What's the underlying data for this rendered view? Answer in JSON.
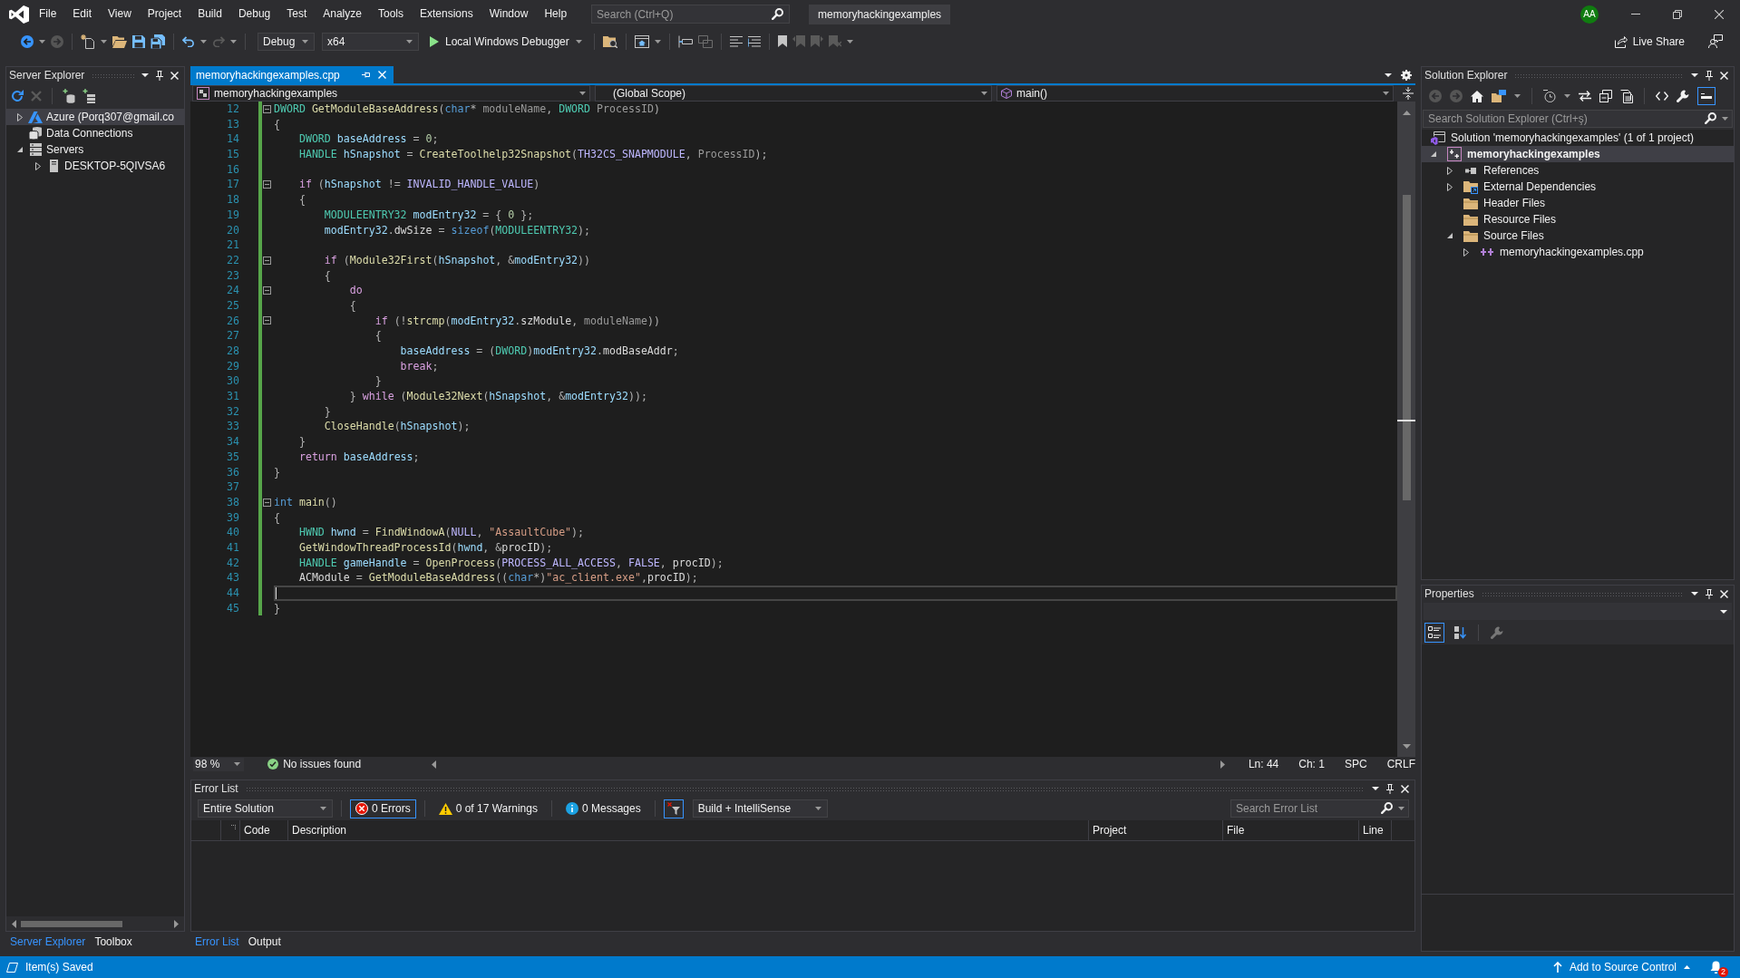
{
  "title_bar": {
    "menu": [
      "File",
      "Edit",
      "View",
      "Project",
      "Build",
      "Debug",
      "Test",
      "Analyze",
      "Tools",
      "Extensions",
      "Window",
      "Help"
    ],
    "search": {
      "placeholder": "Search (Ctrl+Q)"
    },
    "solution_name": "memoryhackingexamples",
    "account_initials": "AA"
  },
  "toolbar": {
    "configuration": "Debug",
    "platform": "x64",
    "debugger": "Local Windows Debugger",
    "live_share": "Live Share"
  },
  "server_explorer": {
    "title": "Server Explorer",
    "tree": [
      {
        "label": "Azure (Porq307@gmail.co",
        "kind": "azure",
        "expanded": false,
        "selected": true
      },
      {
        "label": "Data Connections",
        "kind": "data-connections",
        "selected": false
      },
      {
        "label": "Servers",
        "kind": "servers",
        "expanded": true,
        "selected": false,
        "children": [
          {
            "label": "DESKTOP-5QIVSA6",
            "kind": "server",
            "expanded": false,
            "selected": false
          }
        ]
      }
    ],
    "tabs": [
      {
        "label": "Server Explorer",
        "selected": true
      },
      {
        "label": "Toolbox",
        "selected": false
      }
    ]
  },
  "editor": {
    "tab": {
      "label": "memoryhackingexamples.cpp",
      "selected": true
    },
    "navigation": {
      "project": "memoryhackingexamples",
      "scope": "(Global Scope)",
      "member": "main()"
    },
    "lines": [
      {
        "number": "12",
        "fold": true,
        "current": false,
        "tokens": [
          {
            "kind": "type",
            "text": "DWORD "
          },
          {
            "kind": "function",
            "text": "GetModuleBaseAddress"
          },
          {
            "kind": "plain",
            "text": "("
          },
          {
            "kind": "keyword",
            "text": "char"
          },
          {
            "kind": "plain",
            "text": "* "
          },
          {
            "kind": "parameter",
            "text": "moduleName"
          },
          {
            "kind": "plain",
            "text": ", "
          },
          {
            "kind": "type",
            "text": "DWORD "
          },
          {
            "kind": "parameter",
            "text": "ProcessID"
          },
          {
            "kind": "plain",
            "text": ")"
          }
        ]
      },
      {
        "number": "13",
        "fold": false,
        "current": false,
        "tokens": [
          {
            "kind": "plain",
            "text": "{"
          }
        ]
      },
      {
        "number": "14",
        "fold": false,
        "current": false,
        "tokens": [
          {
            "kind": "type",
            "text": "    DWORD "
          },
          {
            "kind": "variable",
            "text": "baseAddress"
          },
          {
            "kind": "plain",
            "text": " = "
          },
          {
            "kind": "number",
            "text": "0"
          },
          {
            "kind": "plain",
            "text": ";"
          }
        ]
      },
      {
        "number": "15",
        "fold": false,
        "current": false,
        "tokens": [
          {
            "kind": "type",
            "text": "    HANDLE "
          },
          {
            "kind": "variable",
            "text": "hSnapshot"
          },
          {
            "kind": "plain",
            "text": " = "
          },
          {
            "kind": "function",
            "text": "CreateToolhelp32Snapshot"
          },
          {
            "kind": "plain",
            "text": "("
          },
          {
            "kind": "macro",
            "text": "TH32CS_SNAPMODULE"
          },
          {
            "kind": "plain",
            "text": ", "
          },
          {
            "kind": "parameter",
            "text": "ProcessID"
          },
          {
            "kind": "plain",
            "text": ");"
          }
        ]
      },
      {
        "number": "16",
        "fold": false,
        "current": false
      },
      {
        "number": "17",
        "fold": true,
        "current": false,
        "tokens": [
          {
            "kind": "control",
            "text": "    if"
          },
          {
            "kind": "plain",
            "text": " ("
          },
          {
            "kind": "variable",
            "text": "hSnapshot"
          },
          {
            "kind": "plain",
            "text": " != "
          },
          {
            "kind": "macro",
            "text": "INVALID_HANDLE_VALUE"
          },
          {
            "kind": "plain",
            "text": ")"
          }
        ]
      },
      {
        "number": "18",
        "fold": false,
        "current": false,
        "tokens": [
          {
            "kind": "plain",
            "text": "    {"
          }
        ]
      },
      {
        "number": "19",
        "fold": false,
        "current": false,
        "tokens": [
          {
            "kind": "type",
            "text": "        MODULEENTRY32 "
          },
          {
            "kind": "variable",
            "text": "modEntry32"
          },
          {
            "kind": "plain",
            "text": " = { "
          },
          {
            "kind": "number",
            "text": "0"
          },
          {
            "kind": "plain",
            "text": " };"
          }
        ]
      },
      {
        "number": "20",
        "fold": false,
        "current": false,
        "tokens": [
          {
            "kind": "variable",
            "text": "        modEntry32"
          },
          {
            "kind": "plain",
            "text": "."
          },
          {
            "kind": "member",
            "text": "dwSize"
          },
          {
            "kind": "plain",
            "text": " = "
          },
          {
            "kind": "keyword",
            "text": "sizeof"
          },
          {
            "kind": "plain",
            "text": "("
          },
          {
            "kind": "type",
            "text": "MODULEENTRY32"
          },
          {
            "kind": "plain",
            "text": ");"
          }
        ]
      },
      {
        "number": "21",
        "fold": false,
        "current": false
      },
      {
        "number": "22",
        "fold": true,
        "current": false,
        "tokens": [
          {
            "kind": "control",
            "text": "        if"
          },
          {
            "kind": "plain",
            "text": " ("
          },
          {
            "kind": "function",
            "text": "Module32First"
          },
          {
            "kind": "plain",
            "text": "("
          },
          {
            "kind": "variable",
            "text": "hSnapshot"
          },
          {
            "kind": "plain",
            "text": ", &"
          },
          {
            "kind": "variable",
            "text": "modEntry32"
          },
          {
            "kind": "plain",
            "text": "))"
          }
        ]
      },
      {
        "number": "23",
        "fold": false,
        "current": false,
        "tokens": [
          {
            "kind": "plain",
            "text": "        {"
          }
        ]
      },
      {
        "number": "24",
        "fold": true,
        "current": false,
        "tokens": [
          {
            "kind": "control",
            "text": "            do"
          }
        ]
      },
      {
        "number": "25",
        "fold": false,
        "current": false,
        "tokens": [
          {
            "kind": "plain",
            "text": "            {"
          }
        ]
      },
      {
        "number": "26",
        "fold": true,
        "current": false,
        "tokens": [
          {
            "kind": "control",
            "text": "                if"
          },
          {
            "kind": "plain",
            "text": " (!"
          },
          {
            "kind": "function",
            "text": "strcmp"
          },
          {
            "kind": "plain",
            "text": "("
          },
          {
            "kind": "variable",
            "text": "modEntry32"
          },
          {
            "kind": "plain",
            "text": "."
          },
          {
            "kind": "member",
            "text": "szModule"
          },
          {
            "kind": "plain",
            "text": ", "
          },
          {
            "kind": "parameter",
            "text": "moduleName"
          },
          {
            "kind": "plain",
            "text": "))"
          }
        ]
      },
      {
        "number": "27",
        "fold": false,
        "current": false,
        "tokens": [
          {
            "kind": "plain",
            "text": "                {"
          }
        ]
      },
      {
        "number": "28",
        "fold": false,
        "current": false,
        "tokens": [
          {
            "kind": "variable",
            "text": "                    baseAddress"
          },
          {
            "kind": "plain",
            "text": " = ("
          },
          {
            "kind": "type",
            "text": "DWORD"
          },
          {
            "kind": "plain",
            "text": ")"
          },
          {
            "kind": "variable",
            "text": "modEntry32"
          },
          {
            "kind": "plain",
            "text": "."
          },
          {
            "kind": "member",
            "text": "modBaseAddr"
          },
          {
            "kind": "plain",
            "text": ";"
          }
        ]
      },
      {
        "number": "29",
        "fold": false,
        "current": false,
        "tokens": [
          {
            "kind": "control",
            "text": "                    break"
          },
          {
            "kind": "plain",
            "text": ";"
          }
        ]
      },
      {
        "number": "30",
        "fold": false,
        "current": false,
        "tokens": [
          {
            "kind": "plain",
            "text": "                }"
          }
        ]
      },
      {
        "number": "31",
        "fold": false,
        "current": false,
        "tokens": [
          {
            "kind": "plain",
            "text": "            } "
          },
          {
            "kind": "control",
            "text": "while"
          },
          {
            "kind": "plain",
            "text": " ("
          },
          {
            "kind": "function",
            "text": "Module32Next"
          },
          {
            "kind": "plain",
            "text": "("
          },
          {
            "kind": "variable",
            "text": "hSnapshot"
          },
          {
            "kind": "plain",
            "text": ", &"
          },
          {
            "kind": "variable",
            "text": "modEntry32"
          },
          {
            "kind": "plain",
            "text": "));"
          }
        ]
      },
      {
        "number": "32",
        "fold": false,
        "current": false,
        "tokens": [
          {
            "kind": "plain",
            "text": "        }"
          }
        ]
      },
      {
        "number": "33",
        "fold": false,
        "current": false,
        "tokens": [
          {
            "kind": "function",
            "text": "        CloseHandle"
          },
          {
            "kind": "plain",
            "text": "("
          },
          {
            "kind": "variable",
            "text": "hSnapshot"
          },
          {
            "kind": "plain",
            "text": ");"
          }
        ]
      },
      {
        "number": "34",
        "fold": false,
        "current": false,
        "tokens": [
          {
            "kind": "plain",
            "text": "    }"
          }
        ]
      },
      {
        "number": "35",
        "fold": false,
        "current": false,
        "tokens": [
          {
            "kind": "control",
            "text": "    return "
          },
          {
            "kind": "variable",
            "text": "baseAddress"
          },
          {
            "kind": "plain",
            "text": ";"
          }
        ]
      },
      {
        "number": "36",
        "fold": false,
        "current": false,
        "tokens": [
          {
            "kind": "plain",
            "text": "}"
          }
        ]
      },
      {
        "number": "37",
        "fold": false,
        "current": false
      },
      {
        "number": "38",
        "fold": true,
        "current": false,
        "tokens": [
          {
            "kind": "keyword",
            "text": "int "
          },
          {
            "kind": "function",
            "text": "main"
          },
          {
            "kind": "plain",
            "text": "()"
          }
        ]
      },
      {
        "number": "39",
        "fold": false,
        "current": false,
        "tokens": [
          {
            "kind": "plain",
            "text": "{"
          }
        ]
      },
      {
        "number": "40",
        "fold": false,
        "current": false,
        "tokens": [
          {
            "kind": "type",
            "text": "    HWND "
          },
          {
            "kind": "variable",
            "text": "hwnd"
          },
          {
            "kind": "plain",
            "text": " = "
          },
          {
            "kind": "function",
            "text": "FindWindowA"
          },
          {
            "kind": "plain",
            "text": "("
          },
          {
            "kind": "macro",
            "text": "NULL"
          },
          {
            "kind": "plain",
            "text": ", "
          },
          {
            "kind": "string",
            "text": "\"AssaultCube\""
          },
          {
            "kind": "plain",
            "text": ");"
          }
        ]
      },
      {
        "number": "41",
        "fold": false,
        "current": false,
        "tokens": [
          {
            "kind": "function",
            "text": "    GetWindowThreadProcessId"
          },
          {
            "kind": "plain",
            "text": "("
          },
          {
            "kind": "variable",
            "text": "hwnd"
          },
          {
            "kind": "plain",
            "text": ", &"
          },
          {
            "kind": "global",
            "text": "procID"
          },
          {
            "kind": "plain",
            "text": ");"
          }
        ]
      },
      {
        "number": "42",
        "fold": false,
        "current": false,
        "tokens": [
          {
            "kind": "type",
            "text": "    HANDLE "
          },
          {
            "kind": "variable",
            "text": "gameHandle"
          },
          {
            "kind": "plain",
            "text": " = "
          },
          {
            "kind": "function",
            "text": "OpenProcess"
          },
          {
            "kind": "plain",
            "text": "("
          },
          {
            "kind": "macro",
            "text": "PROCESS_ALL_ACCESS"
          },
          {
            "kind": "plain",
            "text": ", "
          },
          {
            "kind": "macro",
            "text": "FALSE"
          },
          {
            "kind": "plain",
            "text": ", "
          },
          {
            "kind": "global",
            "text": "procID"
          },
          {
            "kind": "plain",
            "text": ");"
          }
        ]
      },
      {
        "number": "43",
        "fold": false,
        "current": false,
        "tokens": [
          {
            "kind": "global",
            "text": "    ACModule"
          },
          {
            "kind": "plain",
            "text": " = "
          },
          {
            "kind": "function",
            "text": "GetModuleBaseAddress"
          },
          {
            "kind": "plain",
            "text": "(("
          },
          {
            "kind": "keyword",
            "text": "char"
          },
          {
            "kind": "plain",
            "text": "*)"
          },
          {
            "kind": "string",
            "text": "\"ac_client.exe\""
          },
          {
            "kind": "plain",
            "text": ","
          },
          {
            "kind": "global",
            "text": "procID"
          },
          {
            "kind": "plain",
            "text": ");"
          }
        ]
      },
      {
        "number": "44",
        "fold": false,
        "current": true
      },
      {
        "number": "45",
        "fold": false,
        "current": false,
        "tokens": [
          {
            "kind": "plain",
            "text": "}"
          }
        ]
      }
    ],
    "status": {
      "zoom": "98 %",
      "issues": "No issues found",
      "line": "Ln: 44",
      "column": "Ch: 1",
      "whitespace": "SPC",
      "line_endings": "CRLF"
    }
  },
  "error_list": {
    "title": "Error List",
    "scope": "Entire Solution",
    "filters": [
      {
        "kind": "error",
        "label": "0 Errors",
        "on": true
      },
      {
        "kind": "warning",
        "label": "0 of 17 Warnings",
        "on": false
      },
      {
        "kind": "message",
        "label": "0 Messages",
        "on": false
      }
    ],
    "filter_toggle": {
      "on": true
    },
    "source": "Build + IntelliSense",
    "search": {
      "placeholder": "Search Error List"
    },
    "columns": [
      "Code",
      "Description",
      "Project",
      "File",
      "Line"
    ],
    "tabs": [
      {
        "label": "Error List",
        "selected": true
      },
      {
        "label": "Output",
        "selected": false
      }
    ]
  },
  "solution_explorer": {
    "title": "Solution Explorer",
    "preview_toggle": {
      "on": true
    },
    "search": {
      "placeholder": "Search Solution Explorer (Ctrl+ş)"
    },
    "tree": [
      {
        "label": "Solution 'memoryhackingexamples' (1 of 1 project)",
        "kind": "solution",
        "selected": false,
        "children": [
          {
            "label": "memoryhackingexamples",
            "kind": "project",
            "expanded": true,
            "selected": true,
            "children": [
              {
                "label": "References",
                "kind": "references",
                "expanded": false,
                "selected": false
              },
              {
                "label": "External Dependencies",
                "kind": "external-dependencies",
                "expanded": false,
                "selected": false
              },
              {
                "label": "Header Files",
                "kind": "folder",
                "selected": false
              },
              {
                "label": "Resource Files",
                "kind": "folder",
                "selected": false
              },
              {
                "label": "Source Files",
                "kind": "folder",
                "expanded": true,
                "selected": false,
                "children": [
                  {
                    "label": "memoryhackingexamples.cpp",
                    "kind": "cpp-file",
                    "expanded": false,
                    "selected": false
                  }
                ]
              }
            ]
          }
        ]
      }
    ]
  },
  "properties": {
    "title": "Properties",
    "view_buttons": [
      {
        "kind": "categorized",
        "selected": true
      },
      {
        "kind": "alphabetical",
        "selected": false
      }
    ]
  },
  "status_bar": {
    "message": "Item(s) Saved",
    "source_control": "Add to Source Control",
    "notification_count": "2"
  }
}
